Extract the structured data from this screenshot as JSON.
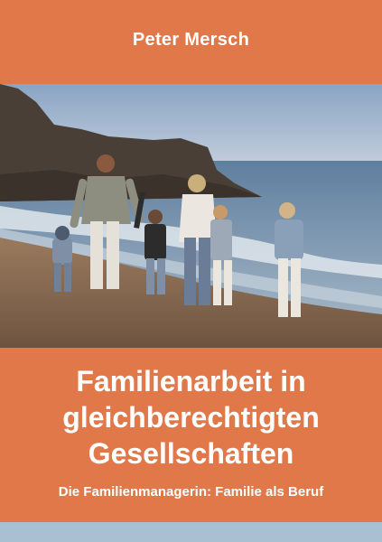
{
  "cover": {
    "author": "Peter Mersch",
    "title_lines": [
      "Familienarbeit in",
      "gleichberechtigten",
      "Gesellschaften"
    ],
    "subtitle": "Die Familienmanagerin: Familie als Beruf"
  },
  "colors": {
    "background": "#e0784a",
    "text": "#ffffff",
    "bottom_strip": "#a9bfd2"
  }
}
